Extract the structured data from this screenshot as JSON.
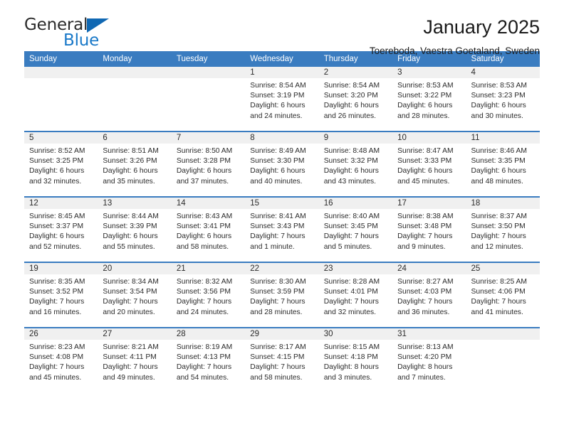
{
  "brand": {
    "name_part1": "General",
    "name_part2": "Blue",
    "accent_color": "#1878c8",
    "triangle_color": "#1068b3"
  },
  "header": {
    "title": "January 2025",
    "subtitle": "Toereboda, Vaestra Goetaland, Sweden",
    "header_bg": "#3a7cc0"
  },
  "weekdays": [
    "Sunday",
    "Monday",
    "Tuesday",
    "Wednesday",
    "Thursday",
    "Friday",
    "Saturday"
  ],
  "weeks": [
    [
      {
        "day": "",
        "sunrise": "",
        "sunset": "",
        "daylight1": "",
        "daylight2": "",
        "empty": true
      },
      {
        "day": "",
        "sunrise": "",
        "sunset": "",
        "daylight1": "",
        "daylight2": "",
        "empty": true
      },
      {
        "day": "",
        "sunrise": "",
        "sunset": "",
        "daylight1": "",
        "daylight2": "",
        "empty": true
      },
      {
        "day": "1",
        "sunrise": "Sunrise: 8:54 AM",
        "sunset": "Sunset: 3:19 PM",
        "daylight1": "Daylight: 6 hours",
        "daylight2": "and 24 minutes."
      },
      {
        "day": "2",
        "sunrise": "Sunrise: 8:54 AM",
        "sunset": "Sunset: 3:20 PM",
        "daylight1": "Daylight: 6 hours",
        "daylight2": "and 26 minutes."
      },
      {
        "day": "3",
        "sunrise": "Sunrise: 8:53 AM",
        "sunset": "Sunset: 3:22 PM",
        "daylight1": "Daylight: 6 hours",
        "daylight2": "and 28 minutes."
      },
      {
        "day": "4",
        "sunrise": "Sunrise: 8:53 AM",
        "sunset": "Sunset: 3:23 PM",
        "daylight1": "Daylight: 6 hours",
        "daylight2": "and 30 minutes."
      }
    ],
    [
      {
        "day": "5",
        "sunrise": "Sunrise: 8:52 AM",
        "sunset": "Sunset: 3:25 PM",
        "daylight1": "Daylight: 6 hours",
        "daylight2": "and 32 minutes."
      },
      {
        "day": "6",
        "sunrise": "Sunrise: 8:51 AM",
        "sunset": "Sunset: 3:26 PM",
        "daylight1": "Daylight: 6 hours",
        "daylight2": "and 35 minutes."
      },
      {
        "day": "7",
        "sunrise": "Sunrise: 8:50 AM",
        "sunset": "Sunset: 3:28 PM",
        "daylight1": "Daylight: 6 hours",
        "daylight2": "and 37 minutes."
      },
      {
        "day": "8",
        "sunrise": "Sunrise: 8:49 AM",
        "sunset": "Sunset: 3:30 PM",
        "daylight1": "Daylight: 6 hours",
        "daylight2": "and 40 minutes."
      },
      {
        "day": "9",
        "sunrise": "Sunrise: 8:48 AM",
        "sunset": "Sunset: 3:32 PM",
        "daylight1": "Daylight: 6 hours",
        "daylight2": "and 43 minutes."
      },
      {
        "day": "10",
        "sunrise": "Sunrise: 8:47 AM",
        "sunset": "Sunset: 3:33 PM",
        "daylight1": "Daylight: 6 hours",
        "daylight2": "and 45 minutes."
      },
      {
        "day": "11",
        "sunrise": "Sunrise: 8:46 AM",
        "sunset": "Sunset: 3:35 PM",
        "daylight1": "Daylight: 6 hours",
        "daylight2": "and 48 minutes."
      }
    ],
    [
      {
        "day": "12",
        "sunrise": "Sunrise: 8:45 AM",
        "sunset": "Sunset: 3:37 PM",
        "daylight1": "Daylight: 6 hours",
        "daylight2": "and 52 minutes."
      },
      {
        "day": "13",
        "sunrise": "Sunrise: 8:44 AM",
        "sunset": "Sunset: 3:39 PM",
        "daylight1": "Daylight: 6 hours",
        "daylight2": "and 55 minutes."
      },
      {
        "day": "14",
        "sunrise": "Sunrise: 8:43 AM",
        "sunset": "Sunset: 3:41 PM",
        "daylight1": "Daylight: 6 hours",
        "daylight2": "and 58 minutes."
      },
      {
        "day": "15",
        "sunrise": "Sunrise: 8:41 AM",
        "sunset": "Sunset: 3:43 PM",
        "daylight1": "Daylight: 7 hours",
        "daylight2": "and 1 minute."
      },
      {
        "day": "16",
        "sunrise": "Sunrise: 8:40 AM",
        "sunset": "Sunset: 3:45 PM",
        "daylight1": "Daylight: 7 hours",
        "daylight2": "and 5 minutes."
      },
      {
        "day": "17",
        "sunrise": "Sunrise: 8:38 AM",
        "sunset": "Sunset: 3:48 PM",
        "daylight1": "Daylight: 7 hours",
        "daylight2": "and 9 minutes."
      },
      {
        "day": "18",
        "sunrise": "Sunrise: 8:37 AM",
        "sunset": "Sunset: 3:50 PM",
        "daylight1": "Daylight: 7 hours",
        "daylight2": "and 12 minutes."
      }
    ],
    [
      {
        "day": "19",
        "sunrise": "Sunrise: 8:35 AM",
        "sunset": "Sunset: 3:52 PM",
        "daylight1": "Daylight: 7 hours",
        "daylight2": "and 16 minutes."
      },
      {
        "day": "20",
        "sunrise": "Sunrise: 8:34 AM",
        "sunset": "Sunset: 3:54 PM",
        "daylight1": "Daylight: 7 hours",
        "daylight2": "and 20 minutes."
      },
      {
        "day": "21",
        "sunrise": "Sunrise: 8:32 AM",
        "sunset": "Sunset: 3:56 PM",
        "daylight1": "Daylight: 7 hours",
        "daylight2": "and 24 minutes."
      },
      {
        "day": "22",
        "sunrise": "Sunrise: 8:30 AM",
        "sunset": "Sunset: 3:59 PM",
        "daylight1": "Daylight: 7 hours",
        "daylight2": "and 28 minutes."
      },
      {
        "day": "23",
        "sunrise": "Sunrise: 8:28 AM",
        "sunset": "Sunset: 4:01 PM",
        "daylight1": "Daylight: 7 hours",
        "daylight2": "and 32 minutes."
      },
      {
        "day": "24",
        "sunrise": "Sunrise: 8:27 AM",
        "sunset": "Sunset: 4:03 PM",
        "daylight1": "Daylight: 7 hours",
        "daylight2": "and 36 minutes."
      },
      {
        "day": "25",
        "sunrise": "Sunrise: 8:25 AM",
        "sunset": "Sunset: 4:06 PM",
        "daylight1": "Daylight: 7 hours",
        "daylight2": "and 41 minutes."
      }
    ],
    [
      {
        "day": "26",
        "sunrise": "Sunrise: 8:23 AM",
        "sunset": "Sunset: 4:08 PM",
        "daylight1": "Daylight: 7 hours",
        "daylight2": "and 45 minutes."
      },
      {
        "day": "27",
        "sunrise": "Sunrise: 8:21 AM",
        "sunset": "Sunset: 4:11 PM",
        "daylight1": "Daylight: 7 hours",
        "daylight2": "and 49 minutes."
      },
      {
        "day": "28",
        "sunrise": "Sunrise: 8:19 AM",
        "sunset": "Sunset: 4:13 PM",
        "daylight1": "Daylight: 7 hours",
        "daylight2": "and 54 minutes."
      },
      {
        "day": "29",
        "sunrise": "Sunrise: 8:17 AM",
        "sunset": "Sunset: 4:15 PM",
        "daylight1": "Daylight: 7 hours",
        "daylight2": "and 58 minutes."
      },
      {
        "day": "30",
        "sunrise": "Sunrise: 8:15 AM",
        "sunset": "Sunset: 4:18 PM",
        "daylight1": "Daylight: 8 hours",
        "daylight2": "and 3 minutes."
      },
      {
        "day": "31",
        "sunrise": "Sunrise: 8:13 AM",
        "sunset": "Sunset: 4:20 PM",
        "daylight1": "Daylight: 8 hours",
        "daylight2": "and 7 minutes."
      },
      {
        "day": "",
        "sunrise": "",
        "sunset": "",
        "daylight1": "",
        "daylight2": "",
        "empty": true
      }
    ]
  ]
}
